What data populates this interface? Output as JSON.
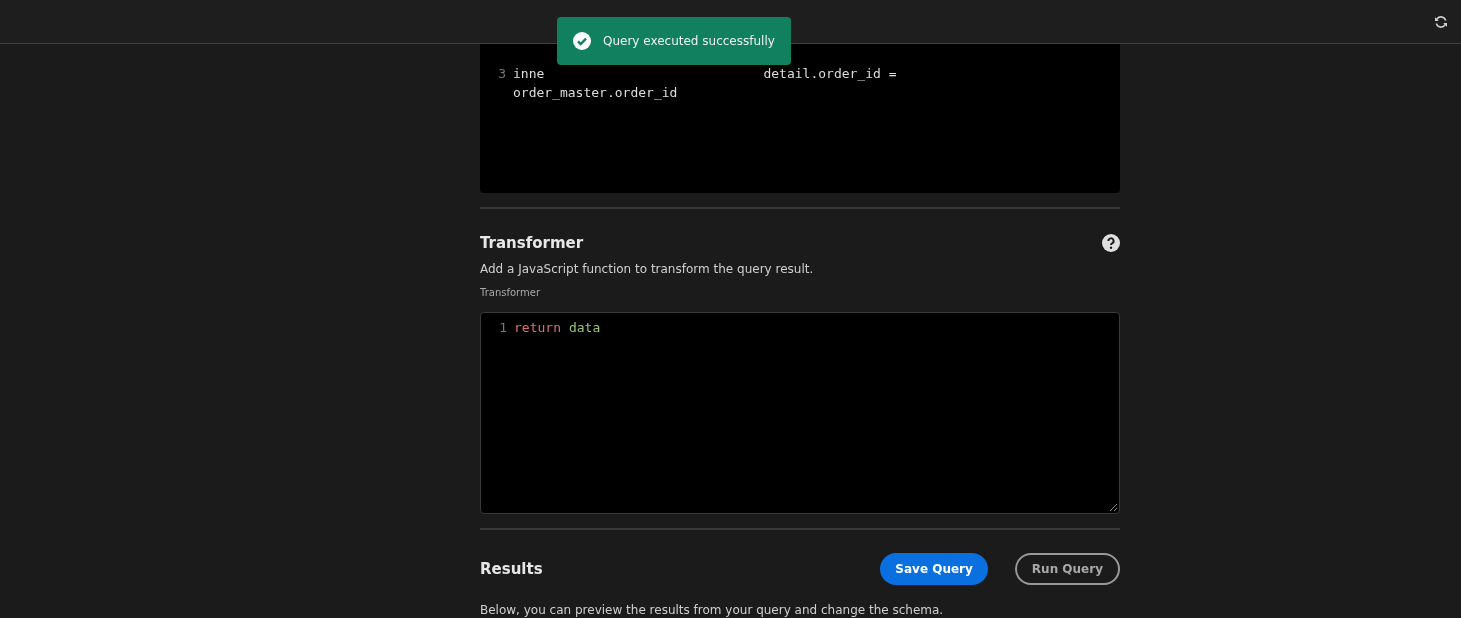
{
  "toast": {
    "kind": "success",
    "message": "Query executed successfully"
  },
  "query_editor": {
    "lines": [
      {
        "number": "3",
        "parts": [
          "inne",
          "detail.order_id ="
        ]
      },
      {
        "parts": [
          "order_master.order_id"
        ]
      }
    ]
  },
  "transformer": {
    "title": "Transformer",
    "description": "Add a JavaScript function to transform the query result.",
    "field_label": "Transformer",
    "lines": [
      {
        "number": "1",
        "tokens": [
          {
            "kind": "keyword",
            "text": "return"
          },
          {
            "kind": "variable",
            "text": "data"
          }
        ]
      }
    ]
  },
  "results": {
    "title": "Results",
    "buttons": [
      {
        "label": "Save Query",
        "kind": "primary"
      },
      {
        "label": "Run Query",
        "kind": "outline"
      }
    ],
    "description": "Below, you can preview the results from your query and change the schema."
  }
}
